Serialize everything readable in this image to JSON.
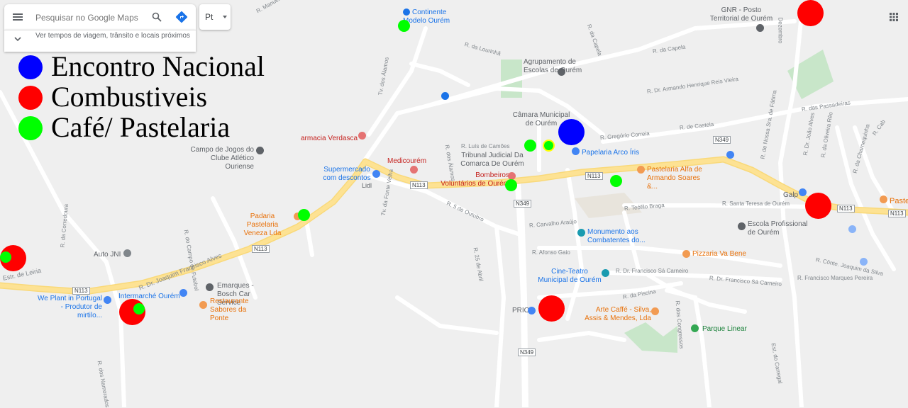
{
  "search": {
    "placeholder": "Pesquisar no Google Maps",
    "travel_info": "Ver tempos de viagem, trânsito e locais próximos",
    "language": "Pt"
  },
  "legend": [
    {
      "label": "Encontro Nacional",
      "color": "#0000ff"
    },
    {
      "label": "Combustiveis",
      "color": "#ff0000"
    },
    {
      "label": "Café/ Pastelaria",
      "color": "#00ff00"
    }
  ],
  "places": {
    "continente": "Continente Modelo Ourém",
    "gnr": "GNR - Posto Territorial de Ourém",
    "agrupamento": "Agrupamento de Escolas de Ourém",
    "camara": "Câmara Municipal de Ourém",
    "farmacia": "armacia Verdasca",
    "campo": "Campo de Jogos do Clube Atlético Ouriense",
    "medicourem": "Medicourém",
    "tribunal": "Tribunal Judicial Da Comarca De Ourém",
    "papelaria": "Papelaria Arco Íris",
    "supermercado": "Supermercado com descontos",
    "lidl": "Lidl",
    "bombeiros": "Bombeiros Voluntários de Ourém",
    "pastelaria_alfa": "Pastelaria Alfa de Armando Soares &...",
    "galp": "Galp",
    "pastel_right": "Pastel",
    "padaria": "Padaria Pastelaria Veneza Lda",
    "escola": "Escola Profissional de Ourém",
    "monumento": "Monumento aos Combatentes do...",
    "pizzaria": "Pizzaria Va Bene",
    "auto_jni": "Auto JNI",
    "cine_teatro": "Cine-Teatro Municipal de Ourém",
    "emarques": "Emarques - Bosch Car Service",
    "intermarche": "Intermarché Ourém",
    "we_plant": "We Plant in Portugal - Produtor de mirtilo...",
    "restaurante": "Restaurante Sabores da Ponte",
    "prio": "PRIO",
    "arte_caffe": "Arte Caffé - Silva, Assis & Mendes, Lda",
    "parque": "Parque Linear"
  },
  "streets": {
    "manuel_david": "R. Manuel David",
    "capela": "R. da Capela",
    "lourinha": "R. da Lourinhã",
    "capela2": "R. da Capela",
    "dezembro": "Dezembro",
    "armando": "R. Dr. Armando Henrique Reis Vieira",
    "passadeiras": "R. das Passadeiras",
    "alamos": "Tv. dos Álamos",
    "r_alamos": "R. dos Álamos",
    "castela": "R. de Castela",
    "gregorio": "R. Gregório Correia",
    "luis_camoes": "R. Luís de Camões",
    "cabo": "R. Cab",
    "joao_alves": "R. Dr. João Alves",
    "nossa_sra": "R. de Nossa Sra. de Fátima",
    "oliveira": "R. da Oliveira Rêo",
    "charnequinha": "R. da Charnequinha",
    "fonte_velha": "Tv. da Fonte Velha",
    "cinco_outubro": "R. 5 de Outubro",
    "santa_teresa": "R. Santa Teresa de Ourém",
    "teofilo": "R. Teófilo Braga",
    "carvalho": "R. Carvalho Araújo",
    "campo_futebol": "R. do Campo de Futebol",
    "corredoura": "R. da Corredoura",
    "vinte_cinco": "R. 25 de Abril",
    "afonso_gaio": "R. Afonso Gaio",
    "joaquim_silva": "R. Cônte. Joaquim da Silva",
    "francisco_carneiro": "R. Dr. Francisco Sá Carneiro",
    "francisco_carneiro2": "R. Dr. Francisco Sá Carneiro",
    "marques_pereira": "R. Francisco Marques Pereira",
    "piscina": "R. da Piscina",
    "congressos": "R. dos Congressos",
    "estr_leiria": "Estr. de Leiria",
    "joaquim_alves": "R. Dr. Joaquim Francisco Alves",
    "namorados": "R. dos Namorados",
    "carregal": "Est. do Carregal"
  },
  "shields": {
    "n113_a": "N113",
    "n113_b": "N113",
    "n113_c": "N113",
    "n113_d": "N113",
    "n113_e": "N113",
    "n113_f": "N113",
    "n349_a": "N349",
    "n349_b": "N349",
    "n349_c": "N349"
  },
  "colors": {
    "encontro": "#0000ff",
    "combustiveis": "#ff0000",
    "cafe": "#00ff00",
    "main_road": "#fde293",
    "map_bg": "#efefef",
    "park": "#c8e6c9"
  }
}
